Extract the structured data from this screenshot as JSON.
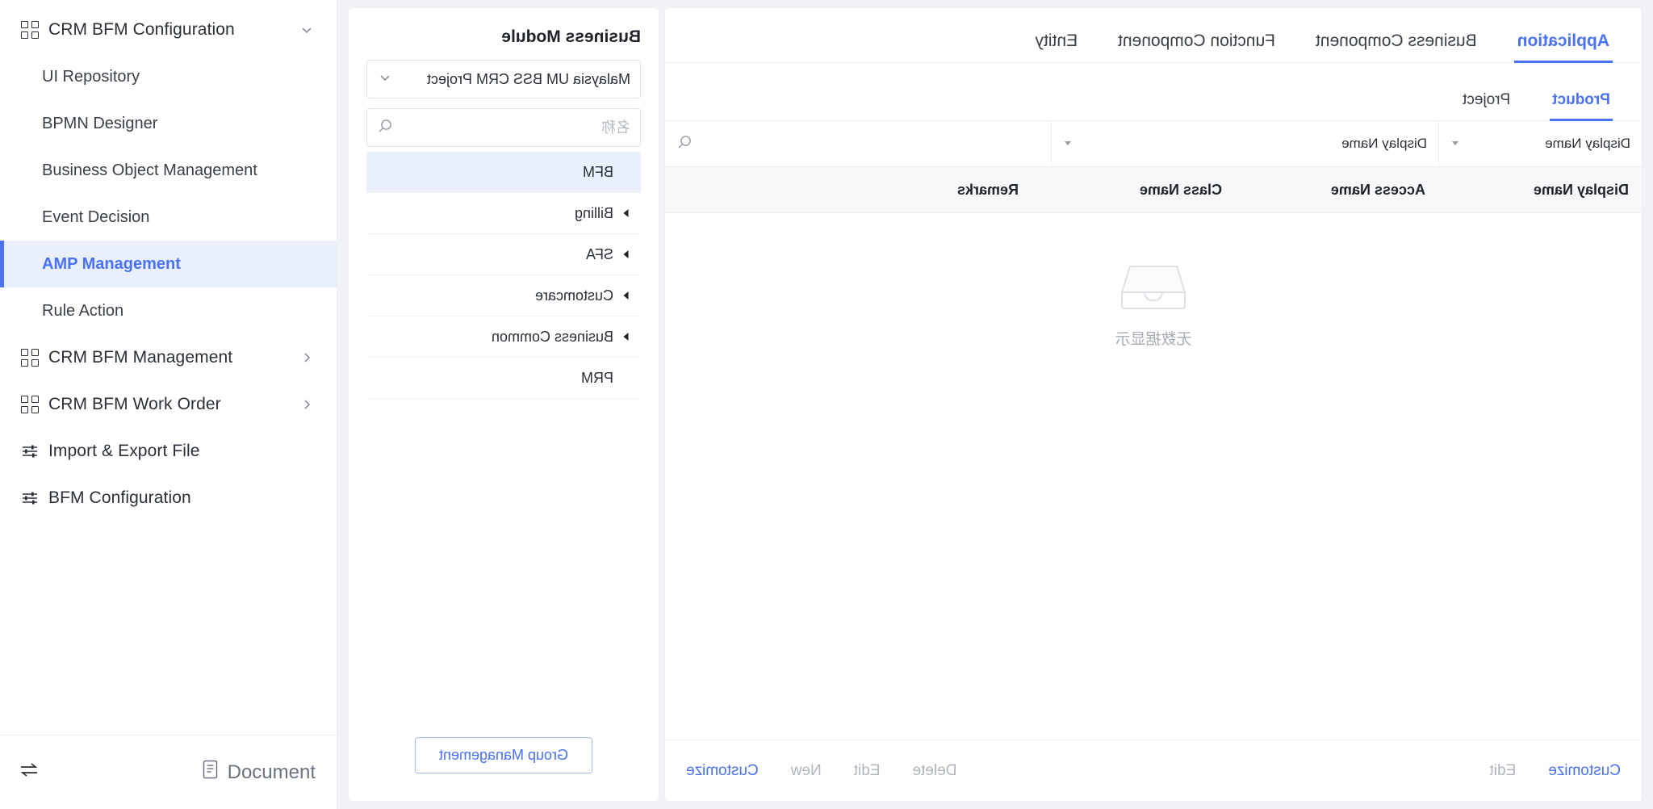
{
  "sidebar": {
    "groups": [
      {
        "label": "CRM BFM Configuration",
        "icon": "grid-icon",
        "chevron": "chevron-down-icon",
        "expanded": true,
        "items": [
          {
            "label": "UI Repository",
            "active": false
          },
          {
            "label": "BPMN Designer",
            "active": false
          },
          {
            "label": "Business Object Management",
            "active": false
          },
          {
            "label": "Event Decision",
            "active": false
          },
          {
            "label": "AMP Management",
            "active": true
          },
          {
            "label": "Rule Action",
            "active": false
          }
        ]
      },
      {
        "label": "CRM BFM Management",
        "icon": "grid-icon",
        "chevron": "chevron-right-icon",
        "expanded": false,
        "items": []
      },
      {
        "label": "CRM BFM Work Order",
        "icon": "grid-icon",
        "chevron": "chevron-right-icon",
        "expanded": false,
        "items": []
      },
      {
        "label": "Import & Export File",
        "icon": "sliders-icon",
        "chevron": "",
        "expanded": false,
        "items": []
      },
      {
        "label": "BFM Configuration",
        "icon": "sliders-icon",
        "chevron": "",
        "expanded": false,
        "items": []
      }
    ],
    "footer": {
      "collapse_icon": "collapse-toggle-icon",
      "document_icon": "document-icon",
      "document_label": "Document"
    }
  },
  "middle_panel": {
    "title": "Business Module",
    "project_select": {
      "value": "Malaysia UM BSS CRM Project",
      "chevron": "chevron-down-icon"
    },
    "search": {
      "placeholder": "名称",
      "value": "",
      "icon": "search-icon"
    },
    "modules": [
      {
        "label": "BFM",
        "selected": true,
        "has_arrow": false
      },
      {
        "label": "Billing",
        "selected": false,
        "has_arrow": true
      },
      {
        "label": "SFA",
        "selected": false,
        "has_arrow": true
      },
      {
        "label": "Customcare",
        "selected": false,
        "has_arrow": true
      },
      {
        "label": "Business Common",
        "selected": false,
        "has_arrow": true
      },
      {
        "label": "PRM",
        "selected": false,
        "has_arrow": false
      }
    ],
    "group_management_button": "Group Management"
  },
  "right_panel": {
    "tabs": [
      {
        "label": "Application",
        "active": true
      },
      {
        "label": "Business Component",
        "active": false
      },
      {
        "label": "Function Component",
        "active": false
      },
      {
        "label": "Entity",
        "active": false
      }
    ],
    "subtabs": [
      {
        "label": "Product",
        "active": true
      },
      {
        "label": "Project",
        "active": false
      }
    ],
    "filters": [
      {
        "label": "Display Name",
        "caret": "caret-down-icon"
      },
      {
        "label": "Display Name",
        "caret": "caret-down-icon"
      }
    ],
    "filter_search": {
      "placeholder": "",
      "value": "",
      "icon": "search-icon"
    },
    "table": {
      "columns": [
        "Display Name",
        "Access Name",
        "Class Name",
        "Remarks"
      ],
      "rows": [],
      "empty_icon": "empty-inbox-icon",
      "empty_text": "无数据显示"
    },
    "actions_left": [
      {
        "label": "Customize",
        "primary": true
      },
      {
        "label": "Edit",
        "primary": false
      }
    ],
    "actions_right": [
      {
        "label": "Delete",
        "primary": false
      },
      {
        "label": "Edit",
        "primary": false
      },
      {
        "label": "New",
        "primary": false
      },
      {
        "label": "Customize",
        "primary": true
      }
    ]
  },
  "colors": {
    "accent": "#4a72f5",
    "accent_bg": "#e9effd",
    "page_bg": "#f0f2f5",
    "panel_bg": "#ffffff",
    "text": "#2b3038",
    "muted": "#b0b5bd",
    "border": "#eceef1"
  }
}
